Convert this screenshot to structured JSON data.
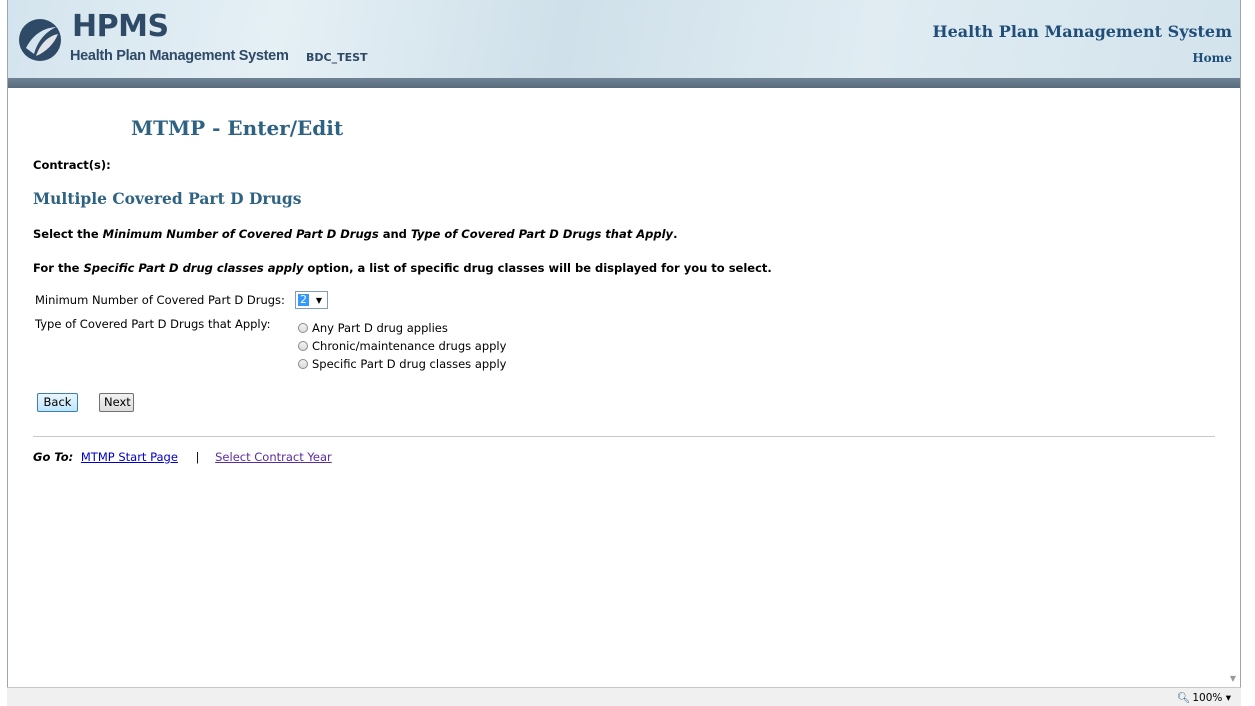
{
  "header": {
    "logo_title": "HPMS",
    "logo_subtitle": "Health Plan Management System",
    "environment": "BDC_TEST",
    "system_title": "Health Plan Management System",
    "home_link": "Home"
  },
  "page": {
    "title": "MTMP - Enter/Edit",
    "contracts_label": "Contract(s):",
    "section_title": "Multiple Covered Part D Drugs"
  },
  "instructions": {
    "line1_a": "Select the ",
    "line1_b": "Minimum Number of Covered Part D Drugs",
    "line1_c": " and ",
    "line1_d": "Type of Covered Part D Drugs that Apply",
    "line1_e": ".",
    "line2_a": "For the ",
    "line2_b": "Specific Part D drug classes apply",
    "line2_c": " option, a list of specific drug classes will be displayed for you to select."
  },
  "form": {
    "min_drugs_label": "Minimum Number of Covered Part D Drugs:",
    "min_drugs_value": "2",
    "type_label": "Type of Covered Part D Drugs that Apply:",
    "options": [
      "Any Part D drug applies",
      "Chronic/maintenance drugs apply",
      "Specific Part D drug classes apply"
    ]
  },
  "buttons": {
    "back": "Back",
    "next": "Next"
  },
  "footer": {
    "goto_label": "Go To:",
    "link_start": "MTMP Start Page",
    "separator": "|",
    "link_year": "Select Contract Year"
  },
  "statusbar": {
    "zoom": "100%",
    "zoom_icon": "magnifier-icon"
  },
  "colors": {
    "header_bg": "#d4e4ee",
    "header_bar": "#5f7283",
    "title_blue": "#2e6283",
    "link_blue": "#0000cc",
    "link_visited": "#5b2c9f"
  }
}
